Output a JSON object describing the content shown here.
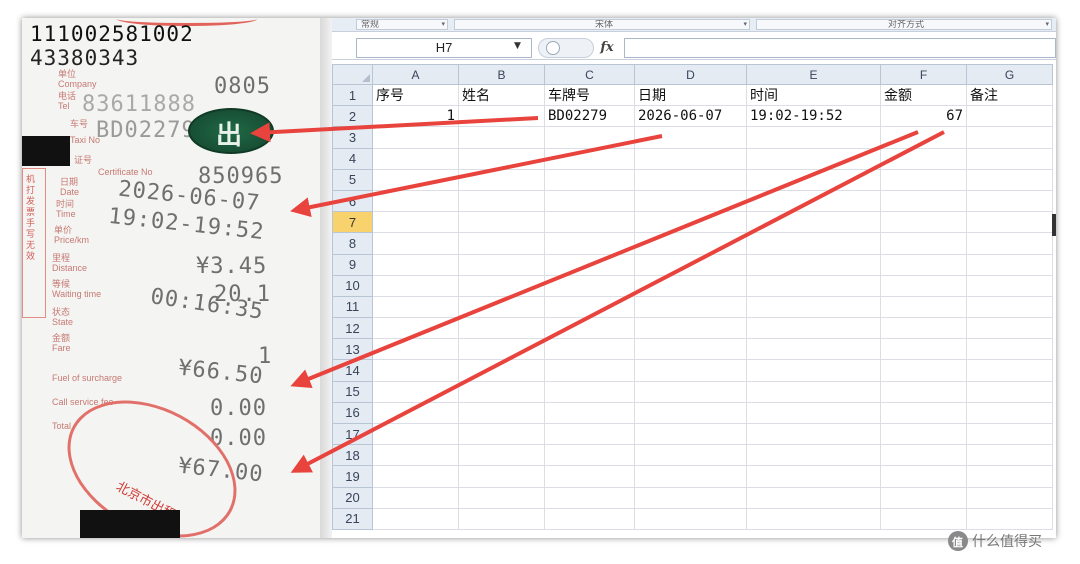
{
  "receipt": {
    "number_line1": "111002581002",
    "number_line2": "43380343",
    "unit_label_cn": "单位",
    "unit_label_en": "Company",
    "unit_value": "0805",
    "phone_label_cn": "电话",
    "phone_label_en": "Tel",
    "phone_value": "83611888",
    "car_label_cn": "车号",
    "car_label_en": "Taxi No",
    "car_value": "BD02279",
    "cert_label_cn": "证号",
    "cert_label_en": "Certificate No",
    "cert_value": "850965",
    "date_label_cn": "日期",
    "date_label_en": "Date",
    "date_value": "2026-06-07",
    "time_label_cn": "时间",
    "time_label_en": "Time",
    "time_value": "19:02-19:52",
    "price_label_cn": "单价",
    "price_label_en": "Price/km",
    "price_value": "¥3.45",
    "distance_label_cn": "里程",
    "distance_label_en": "Distance",
    "distance_value": "20.1",
    "wait_label_cn": "等候",
    "wait_label_en": "Waiting time",
    "wait_value": "00:16:35",
    "state_label_cn": "状态",
    "state_label_en": "State",
    "state_value": "1",
    "fare_label_cn": "金额",
    "fare_label_en": "Fare",
    "fare_value": "¥66.50",
    "fuel_label_en": "Fuel of surcharge",
    "fuel_value": "0.00",
    "call_label_en": "Call service fee",
    "call_value": "0.00",
    "total_label_en": "Total",
    "total_value": "¥67.00",
    "logo_text": "出",
    "stamp_text": "北京市出租",
    "left_box_text": "机打发票 手写无效"
  },
  "ribbon": {
    "font_select": "宋体",
    "style_select": "常规",
    "align_select": "对齐方式"
  },
  "formula_bar": {
    "name_box": "H7",
    "fx_label": "fx",
    "formula_value": ""
  },
  "grid": {
    "corner_label": "",
    "columns": [
      "A",
      "B",
      "C",
      "D",
      "E",
      "F",
      "G"
    ],
    "active_row": 7,
    "rows": [
      {
        "num": "1",
        "cells": [
          "序号",
          "姓名",
          "车牌号",
          "日期",
          "时间",
          "金额",
          "备注"
        ]
      },
      {
        "num": "2",
        "cells": [
          "1",
          "",
          "BD02279",
          "2026-06-07",
          "19:02-19:52",
          "67",
          ""
        ]
      },
      {
        "num": "3",
        "cells": [
          "",
          "",
          "",
          "",
          "",
          "",
          ""
        ]
      },
      {
        "num": "4",
        "cells": [
          "",
          "",
          "",
          "",
          "",
          "",
          ""
        ]
      },
      {
        "num": "5",
        "cells": [
          "",
          "",
          "",
          "",
          "",
          "",
          ""
        ]
      },
      {
        "num": "6",
        "cells": [
          "",
          "",
          "",
          "",
          "",
          "",
          ""
        ]
      },
      {
        "num": "7",
        "cells": [
          "",
          "",
          "",
          "",
          "",
          "",
          ""
        ]
      },
      {
        "num": "8",
        "cells": [
          "",
          "",
          "",
          "",
          "",
          "",
          ""
        ]
      },
      {
        "num": "9",
        "cells": [
          "",
          "",
          "",
          "",
          "",
          "",
          ""
        ]
      },
      {
        "num": "10",
        "cells": [
          "",
          "",
          "",
          "",
          "",
          "",
          ""
        ]
      },
      {
        "num": "11",
        "cells": [
          "",
          "",
          "",
          "",
          "",
          "",
          ""
        ]
      },
      {
        "num": "12",
        "cells": [
          "",
          "",
          "",
          "",
          "",
          "",
          ""
        ]
      },
      {
        "num": "13",
        "cells": [
          "",
          "",
          "",
          "",
          "",
          "",
          ""
        ]
      },
      {
        "num": "14",
        "cells": [
          "",
          "",
          "",
          "",
          "",
          "",
          ""
        ]
      },
      {
        "num": "15",
        "cells": [
          "",
          "",
          "",
          "",
          "",
          "",
          ""
        ]
      },
      {
        "num": "16",
        "cells": [
          "",
          "",
          "",
          "",
          "",
          "",
          ""
        ]
      },
      {
        "num": "17",
        "cells": [
          "",
          "",
          "",
          "",
          "",
          "",
          ""
        ]
      },
      {
        "num": "18",
        "cells": [
          "",
          "",
          "",
          "",
          "",
          "",
          ""
        ]
      },
      {
        "num": "19",
        "cells": [
          "",
          "",
          "",
          "",
          "",
          "",
          ""
        ]
      },
      {
        "num": "20",
        "cells": [
          "",
          "",
          "",
          "",
          "",
          "",
          ""
        ]
      },
      {
        "num": "21",
        "cells": [
          "",
          "",
          "",
          "",
          "",
          "",
          ""
        ]
      }
    ]
  },
  "watermark": {
    "icon": "值",
    "text": "什么值得买"
  },
  "colors": {
    "arrow": "#e8433c",
    "header_bg": "#e4ebf3",
    "active_row_header": "#f7d26d",
    "logo_green": "#1f6a45"
  }
}
